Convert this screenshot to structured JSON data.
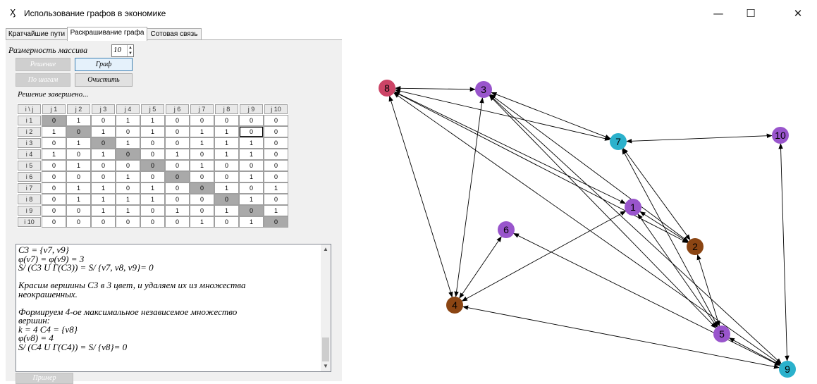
{
  "window": {
    "title": "Использование графов в экономике",
    "icon": "graph-app-icon",
    "controls": [
      "—",
      "☐",
      "✕"
    ]
  },
  "tabs": [
    "Кратчайшие пути",
    "Раскрашивание графа",
    "Сотовая связь"
  ],
  "active_tab": 1,
  "controls": {
    "size_label": "Размерность массива",
    "size_value": "10",
    "solve_button": "Решение",
    "graph_button": "Граф",
    "steps_button": "По шагам",
    "clear_button": "Очистить",
    "status": "Решение завершено...",
    "example_button": "Пример"
  },
  "matrix": {
    "corner": "i \\ j",
    "col_headers": [
      "j 1",
      "j 2",
      "j 3",
      "j 4",
      "j 5",
      "j 6",
      "j 7",
      "j 8",
      "j 9",
      "j 10"
    ],
    "row_headers": [
      "i 1",
      "i 2",
      "i 3",
      "i 4",
      "i 5",
      "i 6",
      "i 7",
      "i 8",
      "i 9",
      "i 10"
    ],
    "rows": [
      [
        "0",
        "1",
        "0",
        "1",
        "1",
        "0",
        "0",
        "0",
        "0",
        "0"
      ],
      [
        "1",
        "0",
        "1",
        "0",
        "1",
        "0",
        "1",
        "1",
        "0",
        "0"
      ],
      [
        "0",
        "1",
        "0",
        "1",
        "0",
        "0",
        "1",
        "1",
        "1",
        "0"
      ],
      [
        "1",
        "0",
        "1",
        "0",
        "0",
        "1",
        "0",
        "1",
        "1",
        "0"
      ],
      [
        "0",
        "1",
        "0",
        "0",
        "0",
        "0",
        "1",
        "0",
        "0",
        "0"
      ],
      [
        "0",
        "0",
        "0",
        "1",
        "0",
        "0",
        "0",
        "0",
        "1",
        "0"
      ],
      [
        "0",
        "1",
        "1",
        "0",
        "1",
        "0",
        "0",
        "1",
        "0",
        "1"
      ],
      [
        "0",
        "1",
        "1",
        "1",
        "1",
        "0",
        "0",
        "0",
        "1",
        "0"
      ],
      [
        "0",
        "0",
        "1",
        "1",
        "0",
        "1",
        "0",
        "1",
        "0",
        "1"
      ],
      [
        "0",
        "0",
        "0",
        "0",
        "0",
        "0",
        "1",
        "0",
        "1",
        "0"
      ]
    ]
  },
  "log_lines": [
    "C3 = {v7, v9}",
    "φ(v7) = φ(v9) = 3",
    "S/ (C3 U Γ(C3)) = S/ {v7, v8, v9}= 0",
    "",
    "Красим вершины C3 в 3 цвет, и удаляем их из множества",
    "неокрашенных.",
    "",
    "Формируем 4-ое максимальное независемое множество",
    "вершин:",
    "k = 4  C4 = {v8}",
    "φ(v8) = 4",
    "S/ (C4 U Γ(C4)) = S/ {v8}= 0"
  ],
  "graph": {
    "colors": {
      "1": "#9955cc",
      "2": "#8b4513",
      "3": "#9955cc",
      "4": "#8b4513",
      "5": "#9955cc",
      "6": "#9955cc",
      "7": "#2bb1cc",
      "8": "#cc4466",
      "9": "#2bb1cc",
      "10": "#9955cc"
    },
    "nodes": [
      "1",
      "2",
      "3",
      "4",
      "5",
      "6",
      "7",
      "8",
      "9",
      "10"
    ],
    "edges": [
      [
        "8",
        "3"
      ],
      [
        "8",
        "7"
      ],
      [
        "8",
        "4"
      ],
      [
        "8",
        "1"
      ],
      [
        "8",
        "2"
      ],
      [
        "8",
        "9"
      ],
      [
        "3",
        "7"
      ],
      [
        "3",
        "4"
      ],
      [
        "3",
        "2"
      ],
      [
        "3",
        "5"
      ],
      [
        "3",
        "9"
      ],
      [
        "7",
        "10"
      ],
      [
        "7",
        "2"
      ],
      [
        "7",
        "5"
      ],
      [
        "1",
        "2"
      ],
      [
        "1",
        "4"
      ],
      [
        "1",
        "5"
      ],
      [
        "6",
        "4"
      ],
      [
        "6",
        "9"
      ],
      [
        "2",
        "5"
      ],
      [
        "4",
        "9"
      ],
      [
        "10",
        "9"
      ],
      [
        "5",
        "9"
      ]
    ]
  }
}
